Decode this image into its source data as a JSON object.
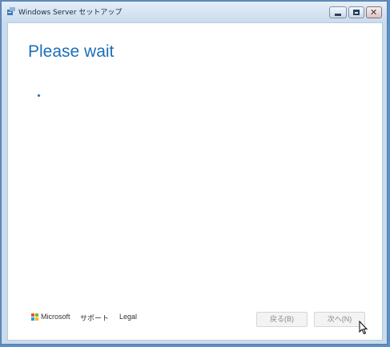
{
  "window": {
    "title": "Windows Server セットアップ",
    "controls": {
      "minimize": "minimize",
      "maximize": "maximize",
      "close": "✕"
    }
  },
  "main": {
    "heading": "Please wait"
  },
  "footer": {
    "brand": "Microsoft",
    "support_link": "サポート",
    "legal_link": "Legal",
    "back_button": "戻る(B)",
    "next_button": "次へ(N)"
  },
  "colors": {
    "heading": "#1c6fb8",
    "window_frame": "#c9dbed",
    "desktop": "#5b8fc7"
  }
}
